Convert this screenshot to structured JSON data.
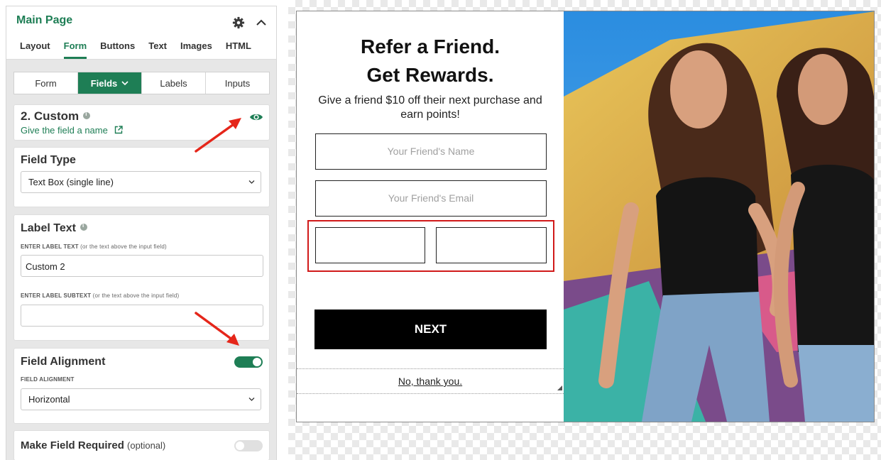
{
  "panel": {
    "title": "Main Page",
    "tabs": [
      "Layout",
      "Form",
      "Buttons",
      "Text",
      "Images",
      "HTML"
    ],
    "active_tab": "Form",
    "subtabs": [
      "Form",
      "Fields",
      "Labels",
      "Inputs"
    ],
    "active_subtab": "Fields"
  },
  "field": {
    "title": "2. Custom",
    "name_link": "Give the field a name"
  },
  "field_type": {
    "title": "Field Type",
    "value": "Text Box (single line)"
  },
  "label_text": {
    "title": "Label Text",
    "label_caption": "ENTER LABEL TEXT",
    "label_note": "(or the text above the input field)",
    "label_value": "Custom 2",
    "subtext_caption": "ENTER LABEL SUBTEXT",
    "subtext_note": "(or the text above the input field)",
    "subtext_value": ""
  },
  "alignment": {
    "title": "Field Alignment",
    "caption": "FIELD ALIGNMENT",
    "value": "Horizontal",
    "enabled": true
  },
  "required": {
    "title": "Make Field Required",
    "note": "(optional)",
    "enabled": false
  },
  "preview": {
    "heading_line1": "Refer a Friend.",
    "heading_line2": "Get Rewards.",
    "subtext": "Give a friend $10 off their next purchase and earn points!",
    "name_placeholder": "Your Friend's Name",
    "email_placeholder": "Your Friend's Email",
    "next_label": "NEXT",
    "no_thanks": "No, thank you."
  },
  "colors": {
    "brand_green": "#1e7e55",
    "highlight_red": "#d11a1a",
    "annotation_arrow": "#e5261a"
  }
}
